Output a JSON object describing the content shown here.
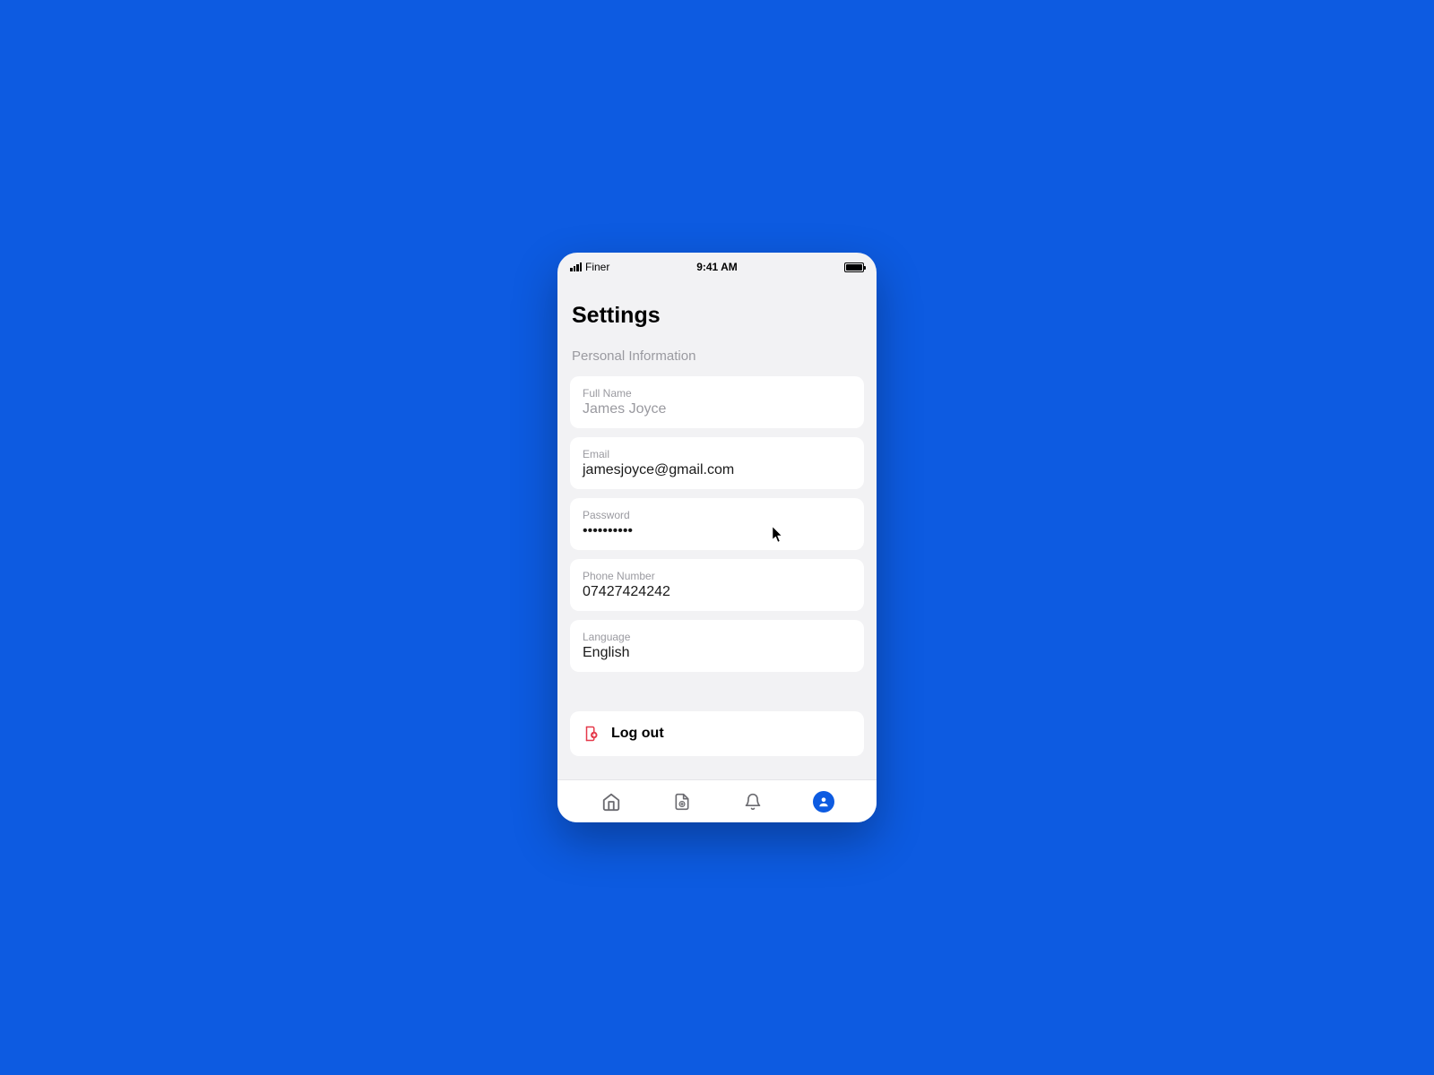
{
  "statusBar": {
    "carrier": "Finer",
    "time": "9:41 AM"
  },
  "page": {
    "title": "Settings",
    "sectionLabel": "Personal Information"
  },
  "fields": {
    "fullName": {
      "label": "Full Name",
      "value": "James Joyce"
    },
    "email": {
      "label": "Email",
      "value": "jamesjoyce@gmail.com"
    },
    "password": {
      "label": "Password",
      "value": "••••••••••"
    },
    "phone": {
      "label": "Phone Number",
      "value": "07427424242"
    },
    "language": {
      "label": "Language",
      "value": "English"
    }
  },
  "logout": {
    "label": "Log out"
  },
  "nav": {
    "items": [
      "home",
      "add-document",
      "notifications",
      "profile"
    ],
    "active": "profile"
  }
}
